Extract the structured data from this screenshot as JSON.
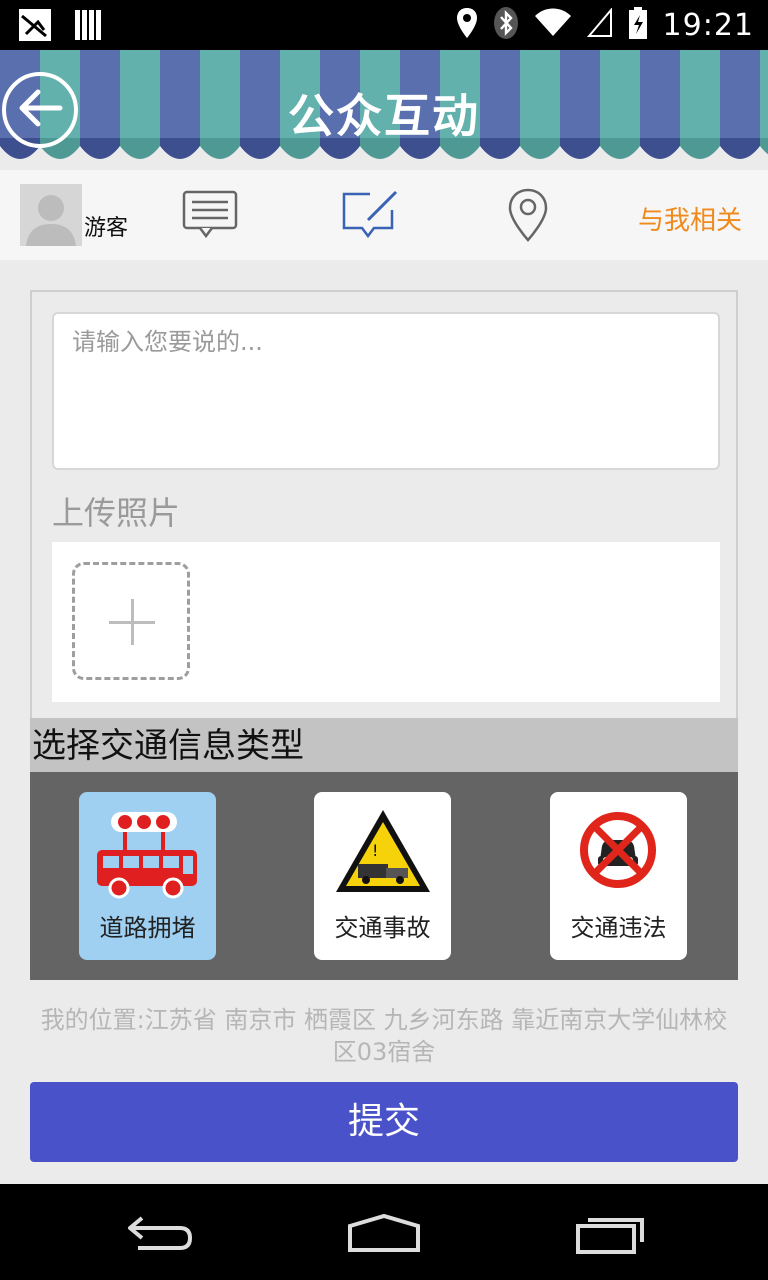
{
  "status_bar": {
    "time": "19:21",
    "icons": [
      "notification-app-icon",
      "signal-bars-icon",
      "location-pin-icon",
      "bluetooth-icon",
      "wifi-icon",
      "cellular-signal-icon",
      "battery-charging-icon"
    ]
  },
  "header": {
    "title": "公众互动",
    "back_icon": "back-arrow-icon",
    "colors": {
      "stripe_blue": "#5a6fae",
      "stripe_teal": "#62b1ad"
    }
  },
  "tabbar": {
    "user_name": "游客",
    "tabs": [
      {
        "icon": "message-list-icon"
      },
      {
        "icon": "compose-icon",
        "active": true,
        "color": "#3a62b5"
      },
      {
        "icon": "location-marker-icon"
      }
    ],
    "related_label": "与我相关",
    "related_color": "#f08a1c"
  },
  "form": {
    "placeholder": "请输入您要说的...",
    "upload_label": "上传照片",
    "add_photo_icon": "plus-icon"
  },
  "traffic_types": {
    "header": "选择交通信息类型",
    "items": [
      {
        "label": "道路拥堵",
        "icon": "bus-congestion-icon",
        "selected": true
      },
      {
        "label": "交通事故",
        "icon": "accident-warning-icon",
        "selected": false
      },
      {
        "label": "交通违法",
        "icon": "no-car-violation-icon",
        "selected": false
      }
    ]
  },
  "location": {
    "text": "我的位置:江苏省 南京市 栖霞区 九乡河东路 靠近南京大学仙林校区03宿舍"
  },
  "submit": {
    "label": "提交",
    "color": "#4a52c9"
  },
  "nav_bar": {
    "icons": [
      "back-nav-icon",
      "home-nav-icon",
      "recents-nav-icon"
    ]
  }
}
